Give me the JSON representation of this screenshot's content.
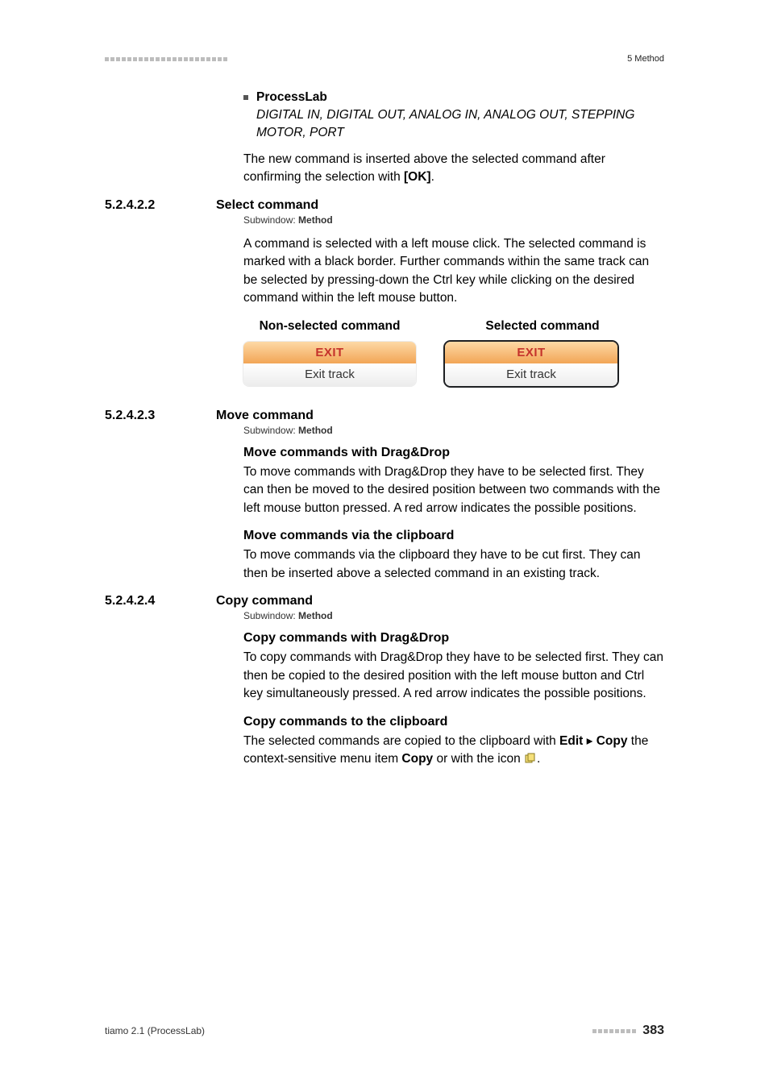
{
  "header_right": "5 Method",
  "bullet_label": "ProcessLab",
  "italic_line": "DIGITAL IN, DIGITAL OUT, ANALOG IN, ANALOG OUT, STEPPING MOTOR, PORT",
  "para_intro": "The new command is inserted above the selected command after confirming the selection with ",
  "para_intro_bold": "[OK]",
  "sec1": {
    "num": "5.2.4.2.2",
    "title": "Select command"
  },
  "subwindow_label": "Subwindow: ",
  "subwindow_value": "Method",
  "sec1_para": "A command is selected with a left mouse click. The selected command is marked with a black border. Further commands within the same track can be selected by pressing-down the Ctrl key while clicking on the desired command within the left mouse button.",
  "tbl_h1": "Non-selected command",
  "tbl_h2": "Selected command",
  "exit_label": "EXIT",
  "exit_sub": "Exit track",
  "sec2": {
    "num": "5.2.4.2.3",
    "title": "Move command"
  },
  "sec2_sub1_title": "Move commands with Drag&Drop",
  "sec2_sub1_para": "To move commands with Drag&Drop they have to be selected first. They can then be moved to the desired position between two commands with the left mouse button pressed. A red arrow indicates the possible positions.",
  "sec2_sub2_title": "Move commands via the clipboard",
  "sec2_sub2_para": "To move commands via the clipboard they have to be cut first. They can then be inserted above a selected command in an existing track.",
  "sec3": {
    "num": "5.2.4.2.4",
    "title": "Copy command"
  },
  "sec3_sub1_title": "Copy commands with Drag&Drop",
  "sec3_sub1_para": "To copy commands with Drag&Drop they have to be selected first. They can then be copied to the desired position with the left mouse button and Ctrl key simultaneously pressed. A red arrow indicates the possible positions.",
  "sec3_sub2_title": "Copy commands to the clipboard",
  "sec3_sub2_para_a": "The selected commands are copied to the clipboard with ",
  "sec3_edit": "Edit",
  "sec3_copy": "Copy",
  "sec3_sub2_para_b": " the context-sensitive menu item ",
  "sec3_sub2_para_c": " or with the icon ",
  "footer_left": "tiamo 2.1 (ProcessLab)",
  "footer_page": "383"
}
